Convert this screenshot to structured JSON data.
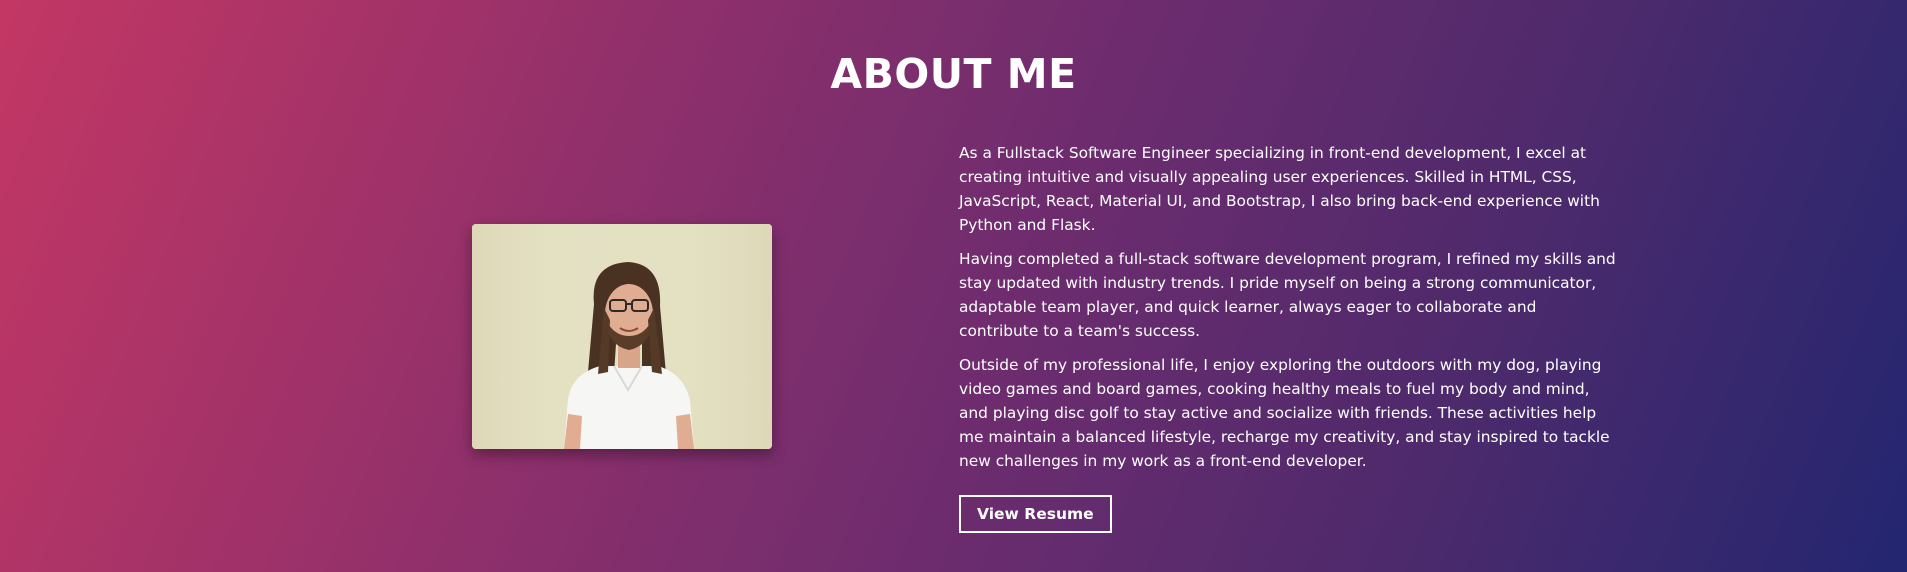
{
  "about": {
    "title": "ABOUT ME",
    "photo_alt": "Portrait photo",
    "paragraphs": [
      "As a Fullstack Software Engineer specializing in front-end development, I excel at creating intuitive and visually appealing user experiences. Skilled in HTML, CSS, JavaScript, React, Material UI, and Bootstrap, I also bring back-end experience with Python and Flask.",
      "Having completed a full-stack software development program, I refined my skills and stay updated with industry trends. I pride myself on being a strong communicator, adaptable team player, and quick learner, always eager to collaborate and contribute to a team's success.",
      "Outside of my professional life, I enjoy exploring the outdoors with my dog, playing video games and board games, cooking healthy meals to fuel my body and mind, and playing disc golf to stay active and socialize with friends. These activities help me maintain a balanced lifestyle, recharge my creativity, and stay inspired to tackle new challenges in my work as a front-end developer."
    ],
    "resume_button_label": "View Resume"
  },
  "colors": {
    "gradient_start": "#c33764",
    "gradient_end": "#232670",
    "text": "#ffffff"
  }
}
